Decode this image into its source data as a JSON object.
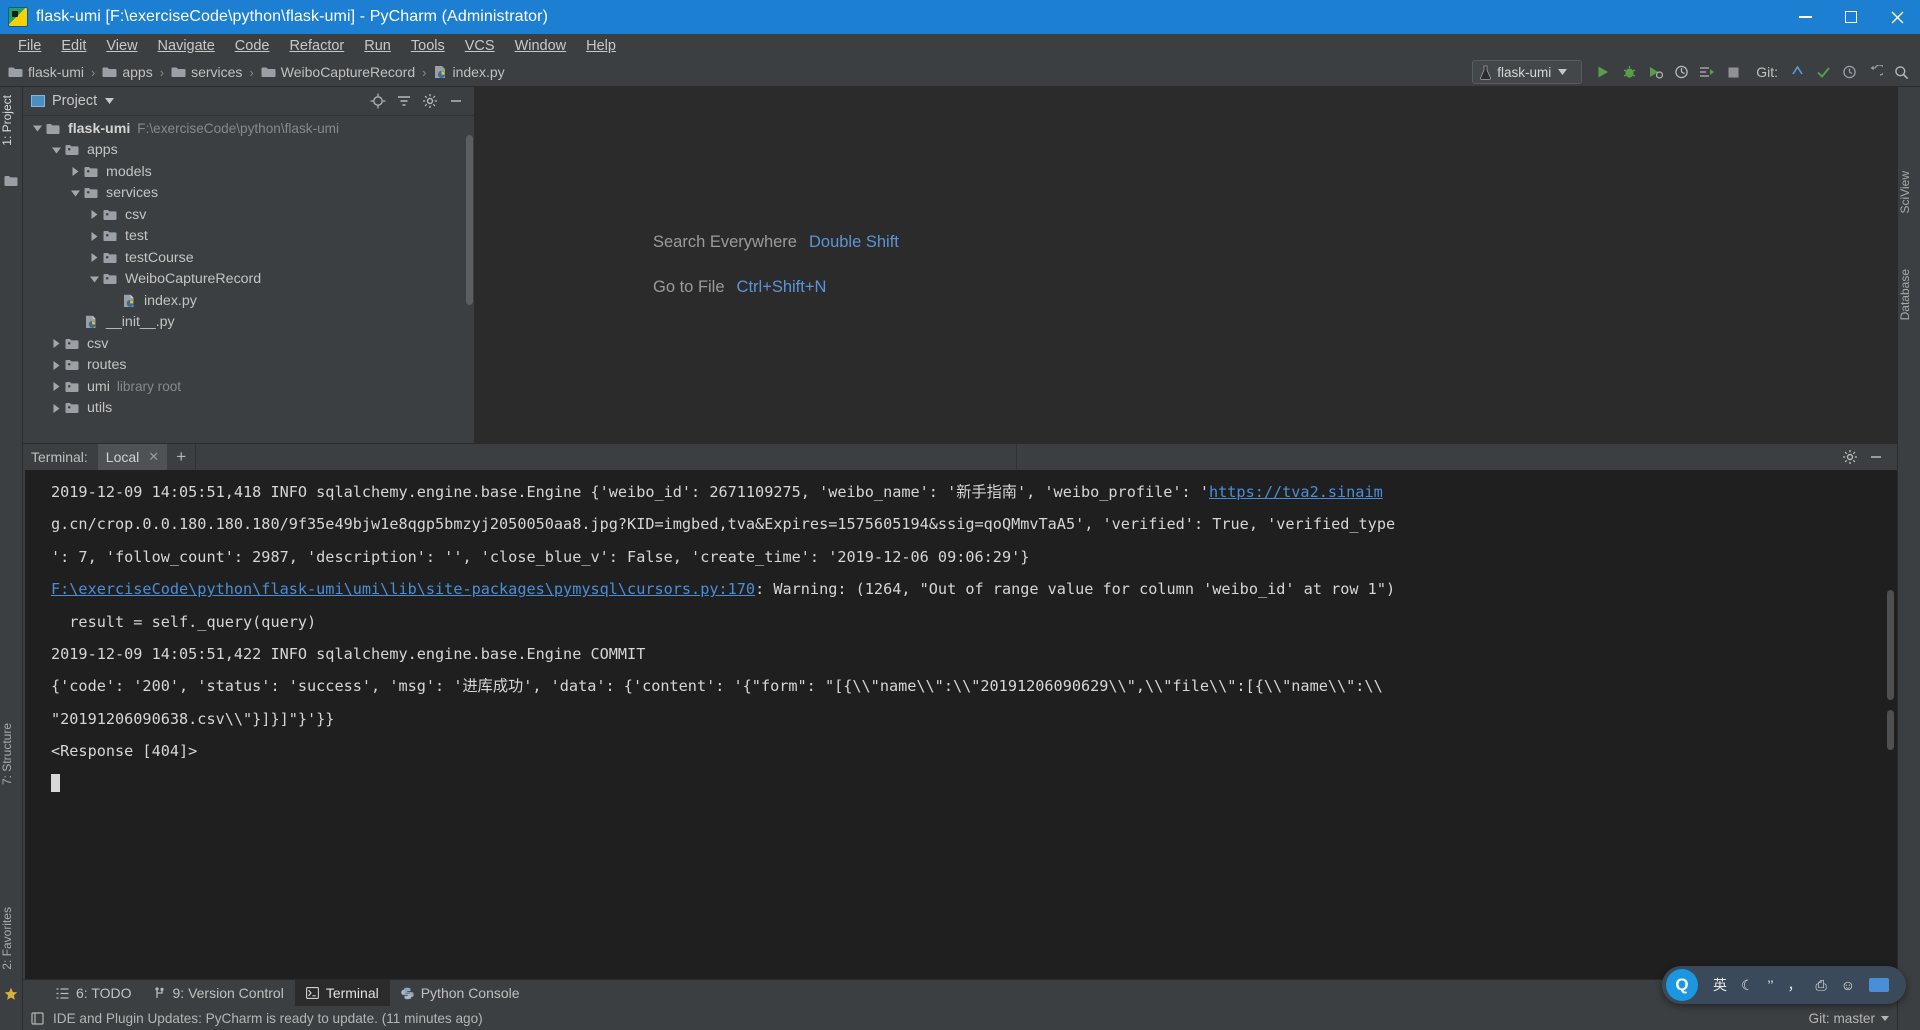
{
  "titlebar": {
    "title": "flask-umi [F:\\exerciseCode\\python\\flask-umi] - PyCharm (Administrator)",
    "icon": "pycharm-logo-icon",
    "minimize": "–",
    "maximize": "□",
    "close": "✕"
  },
  "menubar": {
    "items": [
      {
        "label": "File"
      },
      {
        "label": "Edit"
      },
      {
        "label": "View"
      },
      {
        "label": "Navigate"
      },
      {
        "label": "Code"
      },
      {
        "label": "Refactor"
      },
      {
        "label": "Run"
      },
      {
        "label": "Tools"
      },
      {
        "label": "VCS"
      },
      {
        "label": "Window"
      },
      {
        "label": "Help"
      }
    ]
  },
  "toolbar": {
    "breadcrumb": [
      {
        "label": "flask-umi",
        "icon": "folder-icon"
      },
      {
        "label": "apps",
        "icon": "folder-icon"
      },
      {
        "label": "services",
        "icon": "folder-icon"
      },
      {
        "label": "WeiboCaptureRecord",
        "icon": "folder-icon"
      },
      {
        "label": "index.py",
        "icon": "python-file-icon"
      }
    ],
    "separator": "›",
    "run_config": {
      "label": "flask-umi",
      "icon": "flask-config-icon",
      "caret": "▾"
    },
    "buttons": [
      {
        "name": "run-button",
        "icon": "run-icon"
      },
      {
        "name": "debug-button",
        "icon": "debug-icon"
      },
      {
        "name": "run-coverage-button",
        "icon": "coverage-icon"
      },
      {
        "name": "profile-button",
        "icon": "profile-icon"
      },
      {
        "name": "run-with-console-button",
        "icon": "console-icon"
      },
      {
        "name": "stop-button",
        "icon": "stop-icon"
      }
    ],
    "git_label": "Git:",
    "git_buttons": [
      {
        "name": "update-project-button",
        "icon": "update-icon"
      },
      {
        "name": "commit-button",
        "icon": "commit-check-icon"
      },
      {
        "name": "history-button",
        "icon": "history-clock-icon"
      },
      {
        "name": "rollback-button",
        "icon": "rollback-icon"
      }
    ],
    "search_icon": "search-icon"
  },
  "left_strip": {
    "project_tab": "1: Project",
    "structure_tab": "7: Structure",
    "favorites_tab": "2: Favorites",
    "favorites_icon": "star-icon",
    "structure_icon": "structure-icon"
  },
  "right_strip": {
    "sciview_tab": "SciView",
    "database_tab": "Database"
  },
  "project_panel": {
    "title": "Project",
    "caret": "▾",
    "icon": "project-view-icon",
    "actions": [
      {
        "name": "locate-file-button",
        "icon": "crosshair-icon"
      },
      {
        "name": "collapse-all-button",
        "icon": "collapse-all-icon"
      },
      {
        "name": "settings-button",
        "icon": "gear-icon"
      },
      {
        "name": "hide-button",
        "icon": "minimize-icon"
      }
    ],
    "tree": [
      {
        "label": "flask-umi",
        "sub": "F:\\exerciseCode\\python\\flask-umi",
        "indent": 0,
        "state": "expanded",
        "icon": "folder-icon",
        "bold": true
      },
      {
        "label": "apps",
        "sub": "",
        "indent": 1,
        "state": "expanded",
        "icon": "module-folder-icon",
        "bold": false
      },
      {
        "label": "models",
        "sub": "",
        "indent": 2,
        "state": "collapsed",
        "icon": "module-folder-icon",
        "bold": false
      },
      {
        "label": "services",
        "sub": "",
        "indent": 2,
        "state": "expanded",
        "icon": "module-folder-icon",
        "bold": false
      },
      {
        "label": "csv",
        "sub": "",
        "indent": 3,
        "state": "collapsed",
        "icon": "module-folder-icon",
        "bold": false
      },
      {
        "label": "test",
        "sub": "",
        "indent": 3,
        "state": "collapsed",
        "icon": "module-folder-icon",
        "bold": false
      },
      {
        "label": "testCourse",
        "sub": "",
        "indent": 3,
        "state": "collapsed",
        "icon": "module-folder-icon",
        "bold": false
      },
      {
        "label": "WeiboCaptureRecord",
        "sub": "",
        "indent": 3,
        "state": "expanded",
        "icon": "module-folder-icon",
        "bold": false
      },
      {
        "label": "index.py",
        "sub": "",
        "indent": 4,
        "state": "leaf",
        "icon": "python-file-icon",
        "bold": false
      },
      {
        "label": "__init__.py",
        "sub": "",
        "indent": 2,
        "state": "leaf",
        "icon": "python-file-icon",
        "bold": false
      },
      {
        "label": "csv",
        "sub": "",
        "indent": 1,
        "state": "collapsed",
        "icon": "module-folder-icon",
        "bold": false
      },
      {
        "label": "routes",
        "sub": "",
        "indent": 1,
        "state": "collapsed",
        "icon": "module-folder-icon",
        "bold": false
      },
      {
        "label": "umi",
        "sub": "library root",
        "indent": 1,
        "state": "collapsed",
        "icon": "module-folder-icon",
        "bold": false
      },
      {
        "label": "utils",
        "sub": "",
        "indent": 1,
        "state": "collapsed",
        "icon": "module-folder-icon",
        "bold": false
      }
    ]
  },
  "editor": {
    "hints": [
      {
        "label": "Search Everywhere",
        "key": "Double Shift"
      },
      {
        "label": "Go to File",
        "key": "Ctrl+Shift+N"
      }
    ]
  },
  "terminal": {
    "label": "Terminal:",
    "tab": {
      "label": "Local",
      "close": "✕"
    },
    "add": "+",
    "settings_icon": "gear-icon",
    "hide_icon": "minimize-icon",
    "lines": [
      {
        "segments": [
          {
            "t": "2019-12-09 14:05:51,418 INFO sqlalchemy.engine.base.Engine {'weibo_id': 2671109275, 'weibo_name': '新手指南', 'weibo_profile': '",
            "link": false
          },
          {
            "t": "https://tva2.sinaim",
            "link": true
          }
        ]
      },
      {
        "segments": [
          {
            "t": "g.cn/crop.0.0.180.180.180/9f35e49bjw1e8qgp5bmzyj2050050aa8.jpg?KID=imgbed,tva&Expires=1575605194&ssig=qoQMmvTaA5', 'verified': True, 'verified_type",
            "link": false
          }
        ]
      },
      {
        "segments": [
          {
            "t": "': 7, 'follow_count': 2987, 'description': '', 'close_blue_v': False, 'create_time': '2019-12-06 09:06:29'}",
            "link": false
          }
        ]
      },
      {
        "segments": [
          {
            "t": "F:\\exerciseCode\\python\\flask-umi\\umi\\lib\\site-packages\\pymysql\\cursors.py:170",
            "link": true
          },
          {
            "t": ": Warning: (1264, \"Out of range value for column 'weibo_id' at row 1\")",
            "link": false
          }
        ]
      },
      {
        "segments": [
          {
            "t": "",
            "link": false
          }
        ]
      },
      {
        "segments": [
          {
            "t": "  result = self._query(query)",
            "link": false
          }
        ]
      },
      {
        "segments": [
          {
            "t": "2019-12-09 14:05:51,422 INFO sqlalchemy.engine.base.Engine COMMIT",
            "link": false
          }
        ]
      },
      {
        "segments": [
          {
            "t": "{'code': '200', 'status': 'success', 'msg': '进库成功', 'data': {'content': '{\"form\": \"[{\\\\\"name\\\\\":\\\\\"20191206090629\\\\\",\\\\\"file\\\\\":[{\\\\\"name\\\\\":\\\\",
            "link": false
          }
        ]
      },
      {
        "segments": [
          {
            "t": "\"20191206090638.csv\\\\\"}]}]\"}'}}",
            "link": false
          }
        ]
      },
      {
        "segments": [
          {
            "t": "<Response [404]>",
            "link": false
          }
        ]
      }
    ]
  },
  "bottom_tabs": [
    {
      "label": "6: TODO",
      "accel": "6",
      "icon": "todo-list-icon",
      "selected": false
    },
    {
      "label": "9: Version Control",
      "accel": "9",
      "icon": "branch-icon",
      "selected": false
    },
    {
      "label": "Terminal",
      "accel": "",
      "icon": "terminal-icon",
      "selected": true
    },
    {
      "label": "Python Console",
      "accel": "",
      "icon": "python-icon",
      "selected": false
    }
  ],
  "statusbar": {
    "message": "IDE and Plugin Updates: PyCharm is ready to update. (11 minutes ago)",
    "icon": "notification-icon",
    "git_branch": "Git: master",
    "git_caret": "▾"
  },
  "ime": {
    "logo": "Q",
    "mode": "英",
    "items": [
      {
        "name": "moon-icon",
        "glyph": "☾"
      },
      {
        "name": "quote-icon",
        "glyph": "’’"
      },
      {
        "name": "comma-icon",
        "glyph": "，"
      },
      {
        "name": "toolbox-icon",
        "glyph": "⎙"
      },
      {
        "name": "emoji-icon",
        "glyph": "☺"
      },
      {
        "name": "keyboard-icon",
        "glyph": ""
      }
    ]
  },
  "colors": {
    "title_blue": "#1d7fd1",
    "panel_bg": "#3c3f41",
    "editor_bg": "#2b2b2b",
    "terminal_bg": "#1f1f1f",
    "link_blue": "#4b8ed8",
    "hint_blue": "#5b94d6",
    "run_green": "#5a9e4b"
  }
}
